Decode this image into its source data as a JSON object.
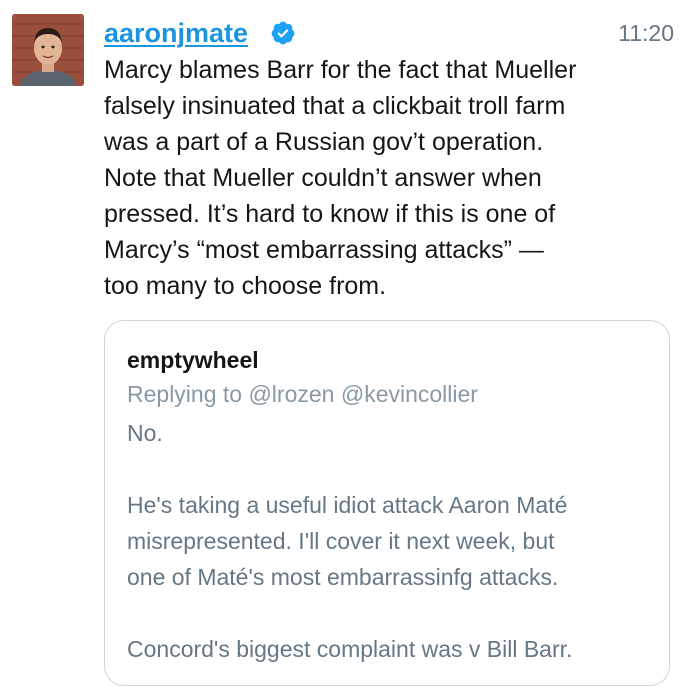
{
  "tweet": {
    "username": "aaronjmate",
    "time": "11:20",
    "text": "Marcy blames Barr for the fact that Mueller\nfalsely insinuated that a clickbait troll farm\nwas a part of a Russian gov’t operation.\nNote that Mueller couldn’t answer when\npressed. It’s hard to know if this is one of\nMarcy’s “most embarrassing attacks” —\ntoo many to choose from.",
    "verified_icon": "verified-badge-icon",
    "avatar_icon": "user-avatar"
  },
  "quote": {
    "author": "emptywheel",
    "reply_line": "Replying to @lrozen @kevincollier",
    "text": "No.\n\nHe's taking a useful idiot attack Aaron Maté\nmisrepresented. I'll cover it next week, but\none of Maté's most embarrassinfg attacks.\n\nConcord's biggest complaint was v Bill Barr."
  },
  "colors": {
    "link": "#1b95e0",
    "text": "#14171a",
    "muted": "#657786",
    "border": "#ccd6dd"
  }
}
